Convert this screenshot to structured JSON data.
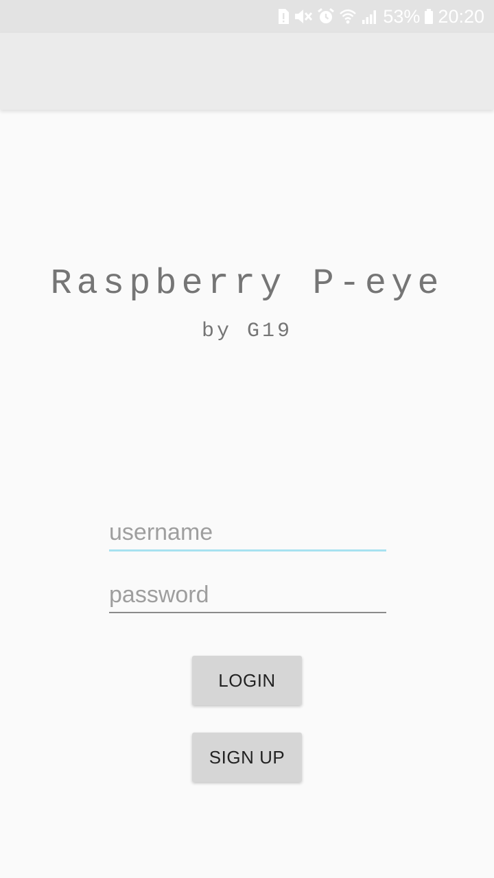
{
  "status_bar": {
    "battery_percent": "53%",
    "time": "20:20",
    "icons": [
      "sim-alert-icon",
      "mute-icon",
      "alarm-icon",
      "wifi-icon",
      "signal-icon",
      "battery-icon"
    ]
  },
  "app": {
    "title": "Raspberry P-eye",
    "subtitle": "by G19"
  },
  "form": {
    "username_placeholder": "username",
    "username_value": "",
    "password_placeholder": "password",
    "password_value": "",
    "login_label": "LOGIN",
    "signup_label": "SIGN UP"
  },
  "colors": {
    "status_bar_bg": "#e3e3e3",
    "app_bar_bg": "#ebebeb",
    "background": "#fafafa",
    "focused_underline": "#a6e1f0",
    "button_bg": "#d6d6d6",
    "title_text": "#757575"
  }
}
